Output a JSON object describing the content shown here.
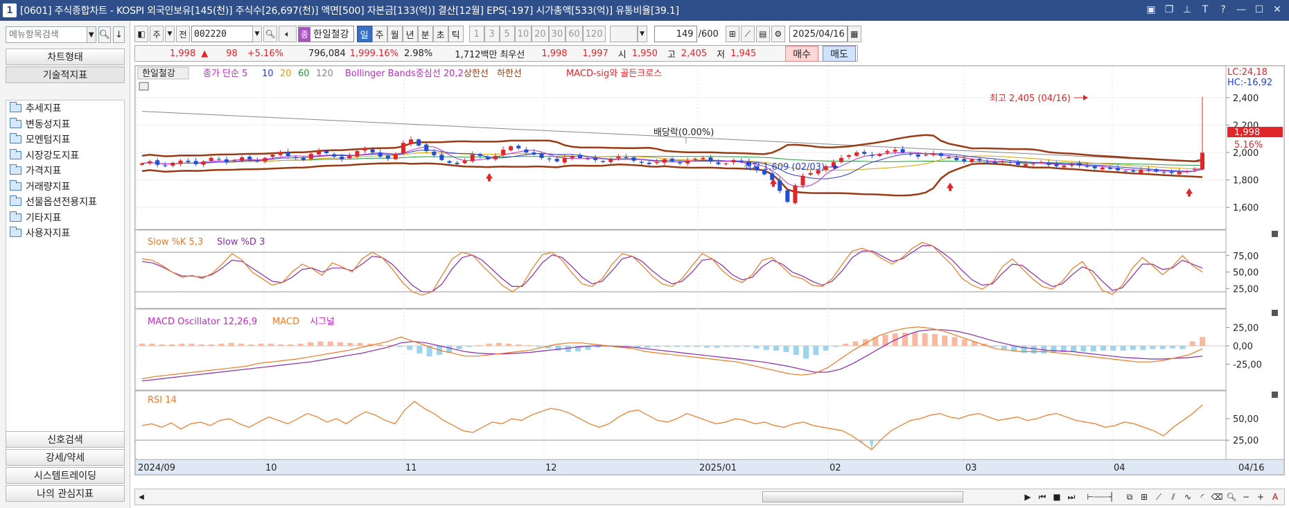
{
  "window": {
    "number": "1",
    "title": "[0601] 주식종합차트 - KOSPI 외국인보유[145(천)] 주식수[26,697(천)] 액면[500] 자본금[133(억)] 결산[12월] EPS[-197] 시가총액[533(억)] 유통비율[39.1]"
  },
  "left_panel": {
    "search_placeholder": "메뉴항목검색",
    "chart_type_label": "차트형태",
    "tech_indicator_label": "기술적지표",
    "tree_items": [
      "추세지표",
      "변동성지표",
      "모멘텀지표",
      "시장강도지표",
      "가격지표",
      "거래량지표",
      "선물옵션전용지표",
      "기타지표",
      "사용자지표"
    ],
    "bottom_buttons": [
      "신호검색",
      "강세/약세",
      "시스템트레이딩",
      "나의 관심지표"
    ]
  },
  "toolbar": {
    "period_prefix": "주",
    "prev_label": "전",
    "stock_code": "002220",
    "stock_badge": "종",
    "stock_name": "한일철강",
    "periods": [
      "일",
      "주",
      "월",
      "년",
      "분",
      "초",
      "틱"
    ],
    "selected_period": "일",
    "intervals": [
      "1",
      "3",
      "5",
      "10",
      "20",
      "30",
      "60",
      "120"
    ],
    "count": "149",
    "count_max": "/600",
    "date": "2025/04/16"
  },
  "quote_bar": {
    "price": "1,998",
    "arrow": "▲",
    "change": "98",
    "change_pct": "+5.16%",
    "volume": "796,084",
    "volume_ratio": "1,999.16%",
    "turnover": "2.98%",
    "amount": "1,712백만",
    "best_label": "최우선",
    "ask": "1,998",
    "bid": "1,997",
    "open_label": "시",
    "open": "1,950",
    "high_label": "고",
    "high": "2,405",
    "low_label": "저",
    "low": "1,945",
    "buy_label": "매수",
    "sell_label": "매도"
  },
  "chart": {
    "legend": {
      "stock": "한일철강",
      "ma_label": "종가 단순 5",
      "ma10": "10",
      "ma20": "20",
      "ma60": "60",
      "ma120": "120",
      "bb_label": "Bollinger Bands중심선 20,2",
      "bb_upper": "상한선",
      "bb_lower": "하한선",
      "macd_sig": "MACD-sig와 골든크로스"
    },
    "lc": "LC:24,18",
    "hc": "HC:-16,92",
    "dividend_label": "배당락(0.00%)",
    "max_label": "최고 2,405 (04/16)",
    "min_label": "최저 1,609 (02/03)",
    "last_price": "1,998",
    "last_pct": "5.16%",
    "price_axis": [
      "2,400",
      "2,200",
      "2,000",
      "1,800",
      "1,600"
    ],
    "stoch_legend": {
      "k": "Slow %K 5,3",
      "d": "Slow %D 3"
    },
    "stoch_axis": [
      "75,00",
      "50,00",
      "25,00"
    ],
    "macd_legend": {
      "osc": "MACD Oscillator 12,26,9",
      "macd": "MACD",
      "signal": "시그널"
    },
    "macd_axis": [
      "25,00",
      "0,00",
      "-25,00"
    ],
    "rsi_legend": "RSI 14",
    "rsi_axis": [
      "50,00",
      "25,00"
    ],
    "x_labels": [
      "2024/09",
      "10",
      "11",
      "12",
      "2025/01",
      "02",
      "03",
      "04"
    ],
    "x_right": "04/16",
    "colors": {
      "up": "#e0262b",
      "down": "#1f4fd8",
      "bollinger": "#9a3a12",
      "ma5": "#c02ac8",
      "ma10": "#2a3ad8",
      "ma20": "#e0a000",
      "ma60": "#1f9a3a",
      "ma120": "#888888",
      "stoch_k": "#f07820",
      "stoch_d": "#8a2ab0",
      "macd_pos": "#f7b9a0",
      "macd_neg": "#9ad4ee",
      "rsi": "#f07820"
    },
    "price_data": {
      "close_series": [
        1920,
        1935,
        1910,
        1900,
        1925,
        1940,
        1930,
        1915,
        1935,
        1960,
        1950,
        1930,
        1945,
        1965,
        1950,
        1935,
        1960,
        1985,
        2000,
        1975,
        1960,
        1945,
        1990,
        2010,
        1995,
        1970,
        1950,
        1975,
        2010,
        2030,
        2000,
        1970,
        1955,
        1990,
        2070,
        2095,
        2050,
        2010,
        1980,
        1945,
        1925,
        1915,
        1940,
        1985,
        1975,
        1950,
        1975,
        2020,
        2045,
        2030,
        2000,
        1985,
        1960,
        1950,
        1935,
        1960,
        1975,
        1960,
        1955,
        1945,
        1930,
        1950,
        1970,
        1960,
        1940,
        1925,
        1915,
        1930,
        1950,
        1935,
        1920,
        1940,
        1955,
        1960,
        1935,
        1915,
        1920,
        1945,
        1930,
        1905,
        1870,
        1840,
        1800,
        1720,
        1640,
        1760,
        1830,
        1850,
        1870,
        1900,
        1930,
        1960,
        1980,
        2000,
        1990,
        1975,
        1990,
        2010,
        2020,
        2000,
        1985,
        1970,
        1985,
        1990,
        1975,
        1960,
        1945,
        1935,
        1950,
        1940,
        1930,
        1920,
        1935,
        1925,
        1910,
        1915,
        1920,
        1930,
        1910,
        1900,
        1905,
        1915,
        1905,
        1895,
        1885,
        1890,
        1880,
        1870,
        1865,
        1860,
        1875,
        1870,
        1860,
        1855,
        1850,
        1860,
        1865,
        1880,
        1998
      ]
    },
    "stoch_k": [
      70,
      68,
      60,
      50,
      42,
      45,
      40,
      48,
      62,
      78,
      68,
      50,
      40,
      30,
      34,
      50,
      62,
      55,
      45,
      64,
      58,
      50,
      70,
      80,
      72,
      55,
      35,
      20,
      15,
      20,
      45,
      70,
      80,
      76,
      60,
      45,
      30,
      20,
      30,
      55,
      76,
      80,
      68,
      48,
      32,
      28,
      40,
      62,
      78,
      74,
      60,
      44,
      32,
      28,
      40,
      60,
      78,
      70,
      52,
      40,
      34,
      46,
      68,
      72,
      58,
      44,
      40,
      30,
      28,
      40,
      62,
      82,
      86,
      80,
      70,
      62,
      72,
      86,
      95,
      90,
      75,
      60,
      40,
      30,
      24,
      34,
      58,
      70,
      55,
      40,
      28,
      24,
      36,
      55,
      66,
      46,
      22,
      16,
      30,
      56,
      72,
      60,
      46,
      58,
      75,
      60,
      50
    ],
    "stoch_d": [
      66,
      64,
      58,
      50,
      44,
      44,
      42,
      46,
      56,
      68,
      66,
      56,
      46,
      36,
      34,
      42,
      54,
      56,
      50,
      56,
      56,
      52,
      62,
      74,
      72,
      62,
      46,
      30,
      20,
      20,
      32,
      55,
      72,
      76,
      68,
      54,
      40,
      28,
      28,
      44,
      64,
      76,
      72,
      58,
      42,
      32,
      36,
      52,
      70,
      74,
      66,
      52,
      40,
      32,
      36,
      50,
      68,
      70,
      60,
      46,
      38,
      42,
      58,
      68,
      62,
      50,
      44,
      36,
      30,
      36,
      52,
      72,
      82,
      82,
      74,
      66,
      70,
      80,
      90,
      90,
      80,
      68,
      52,
      38,
      30,
      32,
      48,
      62,
      60,
      48,
      36,
      28,
      32,
      46,
      58,
      52,
      36,
      22,
      26,
      44,
      62,
      62,
      54,
      56,
      68,
      62,
      56
    ],
    "macd_osc": [
      3,
      3,
      2,
      2,
      3,
      3,
      2,
      2,
      3,
      4,
      3,
      2,
      3,
      3,
      2,
      2,
      3,
      5,
      6,
      6,
      5,
      4,
      4,
      3,
      2,
      1,
      -1,
      -5,
      -10,
      -14,
      -12,
      -9,
      -4,
      -1,
      1,
      3,
      4,
      3,
      2,
      1,
      -1,
      -3,
      -6,
      -8,
      -7,
      -5,
      -2,
      -1,
      -1,
      -1,
      -2,
      -2,
      -1,
      -1,
      -1,
      -1,
      -1,
      -2,
      -2,
      -1,
      -1,
      -1,
      -3,
      -5,
      -6,
      -8,
      -12,
      -17,
      -12,
      -6,
      -1,
      3,
      6,
      9,
      12,
      15,
      17,
      18,
      18,
      17,
      16,
      14,
      12,
      9,
      6,
      3,
      -1,
      -4,
      -7,
      -9,
      -10,
      -10,
      -9,
      -8,
      -7,
      -7,
      -7,
      -6,
      -6,
      -6,
      -5,
      -5,
      -4,
      -4,
      -3,
      -4,
      6,
      12
    ],
    "macd_line": [
      -45,
      -42,
      -40,
      -38,
      -36,
      -34,
      -32,
      -30,
      -28,
      -24,
      -22,
      -20,
      -18,
      -15,
      -12,
      -9,
      -6,
      -2,
      2,
      6,
      12,
      6,
      0,
      -6,
      -10,
      -14,
      -14,
      -12,
      -10,
      -8,
      -6,
      -2,
      2,
      4,
      4,
      2,
      0,
      -2,
      -4,
      -8,
      -10,
      -12,
      -14,
      -16,
      -18,
      -20,
      -22,
      -26,
      -30,
      -34,
      -38,
      -40,
      -38,
      -30,
      -18,
      -6,
      4,
      14,
      20,
      24,
      26,
      24,
      20,
      14,
      8,
      2,
      -4,
      -6,
      -8,
      -8,
      -8,
      -10,
      -12,
      -14,
      -16,
      -18,
      -20,
      -22,
      -22,
      -20,
      -16,
      -12,
      -4
    ],
    "macd_signal": [
      -48,
      -46,
      -44,
      -42,
      -40,
      -38,
      -36,
      -34,
      -32,
      -30,
      -28,
      -26,
      -24,
      -22,
      -19,
      -16,
      -13,
      -10,
      -6,
      -2,
      4,
      6,
      4,
      0,
      -4,
      -8,
      -10,
      -11,
      -11,
      -10,
      -9,
      -7,
      -5,
      -3,
      -1,
      0,
      0,
      -1,
      -2,
      -4,
      -6,
      -8,
      -10,
      -12,
      -14,
      -16,
      -18,
      -20,
      -22,
      -25,
      -28,
      -32,
      -36,
      -36,
      -32,
      -24,
      -14,
      -4,
      6,
      14,
      20,
      22,
      22,
      20,
      16,
      11,
      6,
      2,
      -2,
      -4,
      -6,
      -7,
      -8,
      -10,
      -12,
      -14,
      -16,
      -17,
      -18,
      -18,
      -17,
      -16,
      -14
    ],
    "rsi": [
      42,
      44,
      40,
      45,
      38,
      44,
      46,
      42,
      48,
      50,
      44,
      40,
      46,
      52,
      48,
      44,
      50,
      56,
      52,
      46,
      50,
      44,
      52,
      58,
      54,
      48,
      44,
      60,
      70,
      62,
      56,
      48,
      42,
      36,
      34,
      40,
      46,
      44,
      50,
      48,
      54,
      58,
      62,
      60,
      56,
      50,
      44,
      40,
      44,
      52,
      58,
      60,
      54,
      48,
      46,
      50,
      56,
      52,
      48,
      44,
      46,
      50,
      48,
      44,
      46,
      42,
      40,
      44,
      46,
      42,
      40,
      38,
      36,
      30,
      22,
      14,
      26,
      36,
      42,
      48,
      50,
      54,
      56,
      52,
      50,
      54,
      56,
      52,
      48,
      50,
      52,
      48,
      50,
      54,
      56,
      52,
      48,
      46,
      44,
      40,
      42,
      46,
      44,
      40,
      36,
      30,
      40,
      48,
      56,
      66
    ]
  }
}
